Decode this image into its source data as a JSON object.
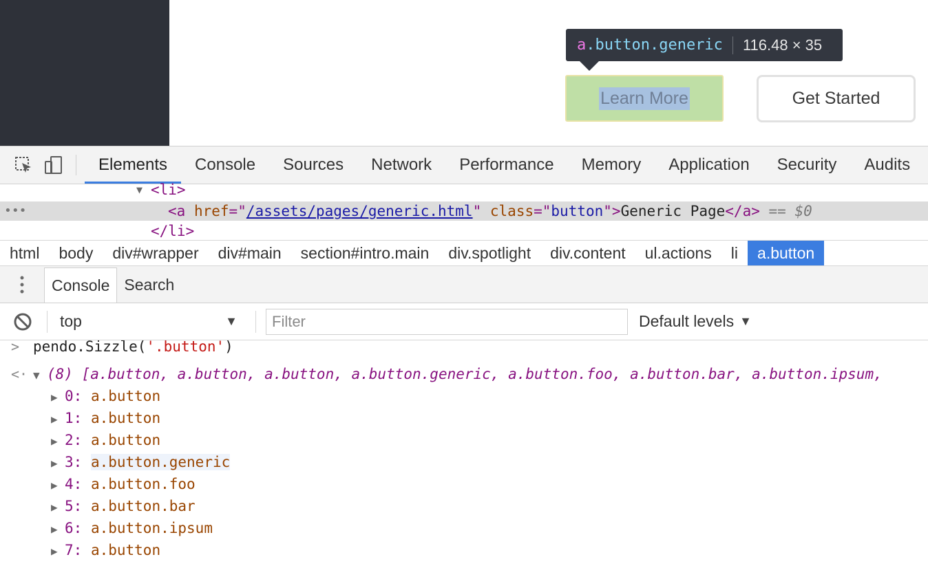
{
  "preview": {
    "tooltip": {
      "tag": "a",
      "classes": ".button.generic",
      "dims": "116.48 × 35"
    },
    "learn_more": "Learn More",
    "get_started": "Get Started"
  },
  "devtools": {
    "tabs": [
      "Elements",
      "Console",
      "Sources",
      "Network",
      "Performance",
      "Memory",
      "Application",
      "Security",
      "Audits"
    ],
    "active_tab": "Elements",
    "dom": {
      "li_open": "<li>",
      "a_tag": "a",
      "href_attr": "href",
      "href_val": "/assets/pages/generic.html",
      "class_attr": "class",
      "class_val": "button",
      "text": "Generic Page",
      "a_close": "</a>",
      "eq": "==",
      "dollar": "$0",
      "li_close": "</li>",
      "ellipsis": "•••"
    },
    "breadcrumbs": [
      "html",
      "body",
      "div#wrapper",
      "div#main",
      "section#intro.main",
      "div.spotlight",
      "div.content",
      "ul.actions",
      "li",
      "a.button"
    ],
    "drawer_tabs": [
      "Console",
      "Search"
    ],
    "console_toolbar": {
      "context": "top",
      "filter_placeholder": "Filter",
      "levels": "Default levels"
    },
    "console": {
      "input": {
        "prefix": "pendo.Sizzle(",
        "arg": "'.button'",
        "suffix": ")"
      },
      "result_summary": "(8) [a.button, a.button, a.button, a.button.generic, a.button.foo, a.button.bar, a.button.ipsum,",
      "items": [
        {
          "key": "0:",
          "value": "a.button"
        },
        {
          "key": "1:",
          "value": "a.button"
        },
        {
          "key": "2:",
          "value": "a.button"
        },
        {
          "key": "3:",
          "value": "a.button.generic"
        },
        {
          "key": "4:",
          "value": "a.button.foo"
        },
        {
          "key": "5:",
          "value": "a.button.bar"
        },
        {
          "key": "6:",
          "value": "a.button.ipsum"
        },
        {
          "key": "7:",
          "value": "a.button"
        }
      ]
    }
  },
  "colors": {
    "accent": "#3b7de0",
    "tooltip_bg": "#333740",
    "sidebar_bg": "#2e3139"
  }
}
